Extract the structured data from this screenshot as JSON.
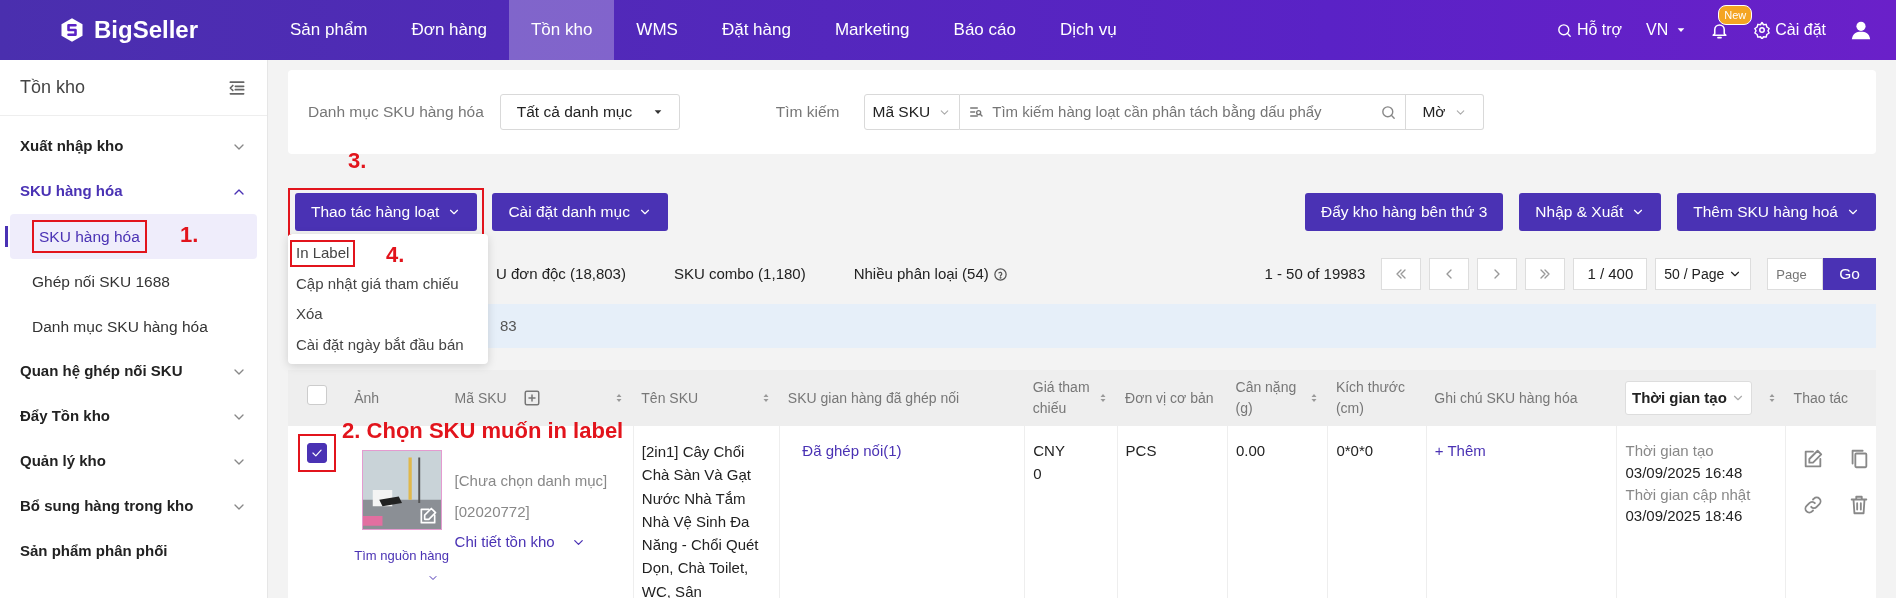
{
  "nav": {
    "brand": "BigSeller",
    "items": [
      {
        "label": "Sản phẩm",
        "selected": false
      },
      {
        "label": "Đơn hàng",
        "selected": false
      },
      {
        "label": "Tồn kho",
        "selected": true
      },
      {
        "label": "WMS",
        "selected": false
      },
      {
        "label": "Đặt hàng",
        "selected": false
      },
      {
        "label": "Marketing",
        "selected": false
      },
      {
        "label": "Báo cáo",
        "selected": false
      },
      {
        "label": "Dịch vụ",
        "selected": false
      }
    ],
    "support": "Hỗ trợ",
    "language": "VN",
    "badge": "New",
    "settings": "Cài đặt"
  },
  "sidebar": {
    "title": "Tồn kho",
    "groups": [
      {
        "label": "Xuất nhập kho",
        "expandable": true,
        "expanded": false,
        "active": false
      },
      {
        "label": "SKU hàng hóa",
        "expandable": true,
        "expanded": true,
        "active": true,
        "children": [
          {
            "label": "SKU hàng hóa",
            "selected": true,
            "callout": "1."
          },
          {
            "label": "Ghép nối SKU 1688",
            "selected": false
          },
          {
            "label": "Danh mục SKU hàng hóa",
            "selected": false
          }
        ]
      },
      {
        "label": "Quan hệ ghép nối SKU",
        "expandable": true,
        "expanded": false,
        "active": false
      },
      {
        "label": "Đẩy Tồn kho",
        "expandable": true,
        "expanded": false,
        "active": false
      },
      {
        "label": "Quản lý kho",
        "expandable": true,
        "expanded": false,
        "active": false
      },
      {
        "label": "Bổ sung hàng trong kho",
        "expandable": true,
        "expanded": false,
        "active": false
      },
      {
        "label": "Sản phẩm phân phối",
        "expandable": false,
        "active": false
      }
    ]
  },
  "filters": {
    "category_label": "Danh mục SKU hàng hóa",
    "category_value": "Tất cả danh mục",
    "search_label": "Tìm kiếm",
    "search_field": "Mã SKU",
    "search_placeholder": "Tìm kiếm hàng loạt cần phân tách bằng dấu phẩy",
    "match": "Mờ"
  },
  "toolbar": {
    "left": [
      {
        "label": "Thao tác hàng loạt",
        "caret": true,
        "callout": "3."
      },
      {
        "label": "Cài đặt danh mục",
        "caret": true
      }
    ],
    "right": [
      {
        "label": "Đẩy kho hàng bên thứ 3",
        "caret": false
      },
      {
        "label": "Nhập & Xuất",
        "caret": true
      },
      {
        "label": "Thêm SKU hàng hoá",
        "caret": true
      }
    ]
  },
  "batch_menu": [
    {
      "label": "In Label",
      "callout": "4."
    },
    {
      "label": "Cập nhật giá tham chiếu"
    },
    {
      "label": "Xóa"
    },
    {
      "label": "Cài đặt ngày bắt đầu bán"
    }
  ],
  "tabs": [
    {
      "label": "U đơn độc (18,803)",
      "help": false
    },
    {
      "label": "SKU combo (1,180)",
      "help": false
    },
    {
      "label": "Nhiều phân loại (54)",
      "help": true
    }
  ],
  "pagination": {
    "summary": "1 - 50 of 19983",
    "page": "1 / 400",
    "page_size": "50 / Page",
    "page_placeholder": "Page",
    "go": "Go"
  },
  "selection_info": "83",
  "table": {
    "header_checked": false,
    "columns": [
      {
        "label": "Ảnh",
        "sortable": false
      },
      {
        "label": "Mã SKU",
        "sortable": true,
        "add": true
      },
      {
        "label": "Tên SKU",
        "sortable": true
      },
      {
        "label": "SKU gian hàng đã ghép nối",
        "sortable": false
      },
      {
        "label": "Giá tham chiếu",
        "sortable": true
      },
      {
        "label": "Đơn vị cơ bản",
        "sortable": false
      },
      {
        "label": "Cân nặng (g)",
        "sortable": true
      },
      {
        "label": "Kích thước (cm)",
        "sortable": false
      },
      {
        "label": "Ghi chú SKU hàng hóa",
        "sortable": false
      },
      {
        "label": "Thời gian tạo",
        "sortable": true,
        "kind": "select"
      },
      {
        "label": "Thao tác",
        "sortable": false
      }
    ],
    "rows": [
      {
        "checked": true,
        "callout": "2. Chọn SKU muốn in label",
        "source_link": "Tìm nguồn hàng",
        "category": "[Chưa chọn danh mục]",
        "code": "[02020772]",
        "stock_link": "Chi tiết tồn kho",
        "name": "[2in1] Cây Chổi Chà Sàn Và Gạt Nước Nhà Tắm Nhà Vệ Sinh Đa Năng - Chổi Quét Dọn, Chà Toilet, WC, Sân",
        "linked": "Đã ghép nối(1)",
        "currency": "CNY",
        "price": "0",
        "unit": "PCS",
        "weight": "0.00",
        "size": "0*0*0",
        "note_action": "+ Thêm",
        "created_label": "Thời gian tạo",
        "created": "03/09/2025 16:48",
        "updated_label": "Thời gian cập nhật",
        "updated": "03/09/2025 18:46"
      }
    ]
  }
}
